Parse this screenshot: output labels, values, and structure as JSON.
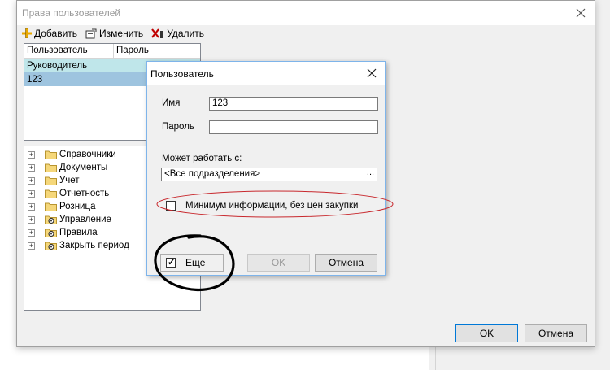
{
  "window": {
    "title": "Права пользователей"
  },
  "toolbar": {
    "add_label": "Добавить",
    "edit_label": "Изменить",
    "delete_label": "Удалить"
  },
  "users_table": {
    "columns": [
      "Пользователь",
      "Пароль"
    ],
    "rows": [
      {
        "user": "Руководитель",
        "password": ""
      },
      {
        "user": "123",
        "password": ""
      }
    ]
  },
  "tree": {
    "items": [
      {
        "label": "Справочники",
        "icon": "folder-icon"
      },
      {
        "label": "Документы",
        "icon": "folder-icon"
      },
      {
        "label": "Учет",
        "icon": "folder-icon"
      },
      {
        "label": "Отчетность",
        "icon": "folder-icon"
      },
      {
        "label": "Розница",
        "icon": "folder-icon"
      },
      {
        "label": "Управление",
        "icon": "gear-folder-icon"
      },
      {
        "label": "Правила",
        "icon": "gear-folder-icon"
      },
      {
        "label": "Закрыть период",
        "icon": "gear-folder-icon"
      }
    ]
  },
  "main_buttons": {
    "ok": "OK",
    "cancel": "Отмена"
  },
  "dialog": {
    "title": "Пользователь",
    "name_label": "Имя",
    "name_value": "123",
    "password_label": "Пароль",
    "password_value": "",
    "works_with_label": "Может работать с:",
    "works_with_value": "<Все подразделения>",
    "ellipsis": "...",
    "min_info_label": "Минимум информации, без цен закупки",
    "min_info_checked": false,
    "more_label": "Еще",
    "more_checked": true,
    "ok": "OK",
    "cancel": "Отмена"
  },
  "colors": {
    "accent": "#0078d7",
    "row_selected": "#9ec4df",
    "row_highlight": "#bfe6ea",
    "annotation_red": "#c8282d",
    "annotation_black": "#000000"
  }
}
